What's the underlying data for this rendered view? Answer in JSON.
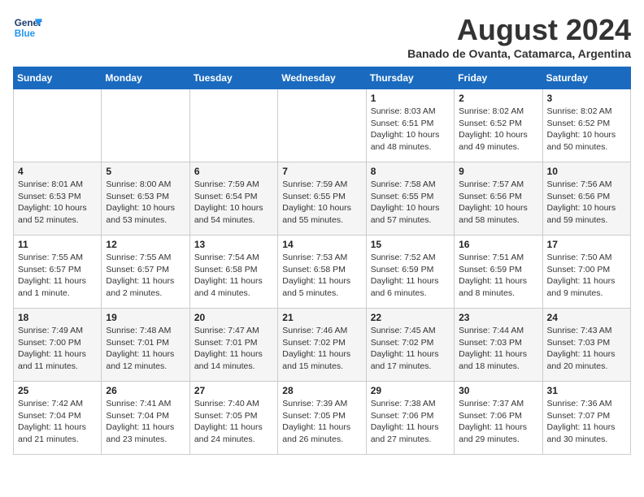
{
  "header": {
    "logo_line1": "General",
    "logo_line2": "Blue",
    "month_year": "August 2024",
    "location": "Banado de Ovanta, Catamarca, Argentina"
  },
  "days_of_week": [
    "Sunday",
    "Monday",
    "Tuesday",
    "Wednesday",
    "Thursday",
    "Friday",
    "Saturday"
  ],
  "weeks": [
    [
      {
        "day": "",
        "sunrise": "",
        "sunset": "",
        "daylight": ""
      },
      {
        "day": "",
        "sunrise": "",
        "sunset": "",
        "daylight": ""
      },
      {
        "day": "",
        "sunrise": "",
        "sunset": "",
        "daylight": ""
      },
      {
        "day": "",
        "sunrise": "",
        "sunset": "",
        "daylight": ""
      },
      {
        "day": "1",
        "sunrise": "Sunrise: 8:03 AM",
        "sunset": "Sunset: 6:51 PM",
        "daylight": "Daylight: 10 hours and 48 minutes."
      },
      {
        "day": "2",
        "sunrise": "Sunrise: 8:02 AM",
        "sunset": "Sunset: 6:52 PM",
        "daylight": "Daylight: 10 hours and 49 minutes."
      },
      {
        "day": "3",
        "sunrise": "Sunrise: 8:02 AM",
        "sunset": "Sunset: 6:52 PM",
        "daylight": "Daylight: 10 hours and 50 minutes."
      }
    ],
    [
      {
        "day": "4",
        "sunrise": "Sunrise: 8:01 AM",
        "sunset": "Sunset: 6:53 PM",
        "daylight": "Daylight: 10 hours and 52 minutes."
      },
      {
        "day": "5",
        "sunrise": "Sunrise: 8:00 AM",
        "sunset": "Sunset: 6:53 PM",
        "daylight": "Daylight: 10 hours and 53 minutes."
      },
      {
        "day": "6",
        "sunrise": "Sunrise: 7:59 AM",
        "sunset": "Sunset: 6:54 PM",
        "daylight": "Daylight: 10 hours and 54 minutes."
      },
      {
        "day": "7",
        "sunrise": "Sunrise: 7:59 AM",
        "sunset": "Sunset: 6:55 PM",
        "daylight": "Daylight: 10 hours and 55 minutes."
      },
      {
        "day": "8",
        "sunrise": "Sunrise: 7:58 AM",
        "sunset": "Sunset: 6:55 PM",
        "daylight": "Daylight: 10 hours and 57 minutes."
      },
      {
        "day": "9",
        "sunrise": "Sunrise: 7:57 AM",
        "sunset": "Sunset: 6:56 PM",
        "daylight": "Daylight: 10 hours and 58 minutes."
      },
      {
        "day": "10",
        "sunrise": "Sunrise: 7:56 AM",
        "sunset": "Sunset: 6:56 PM",
        "daylight": "Daylight: 10 hours and 59 minutes."
      }
    ],
    [
      {
        "day": "11",
        "sunrise": "Sunrise: 7:55 AM",
        "sunset": "Sunset: 6:57 PM",
        "daylight": "Daylight: 11 hours and 1 minute."
      },
      {
        "day": "12",
        "sunrise": "Sunrise: 7:55 AM",
        "sunset": "Sunset: 6:57 PM",
        "daylight": "Daylight: 11 hours and 2 minutes."
      },
      {
        "day": "13",
        "sunrise": "Sunrise: 7:54 AM",
        "sunset": "Sunset: 6:58 PM",
        "daylight": "Daylight: 11 hours and 4 minutes."
      },
      {
        "day": "14",
        "sunrise": "Sunrise: 7:53 AM",
        "sunset": "Sunset: 6:58 PM",
        "daylight": "Daylight: 11 hours and 5 minutes."
      },
      {
        "day": "15",
        "sunrise": "Sunrise: 7:52 AM",
        "sunset": "Sunset: 6:59 PM",
        "daylight": "Daylight: 11 hours and 6 minutes."
      },
      {
        "day": "16",
        "sunrise": "Sunrise: 7:51 AM",
        "sunset": "Sunset: 6:59 PM",
        "daylight": "Daylight: 11 hours and 8 minutes."
      },
      {
        "day": "17",
        "sunrise": "Sunrise: 7:50 AM",
        "sunset": "Sunset: 7:00 PM",
        "daylight": "Daylight: 11 hours and 9 minutes."
      }
    ],
    [
      {
        "day": "18",
        "sunrise": "Sunrise: 7:49 AM",
        "sunset": "Sunset: 7:00 PM",
        "daylight": "Daylight: 11 hours and 11 minutes."
      },
      {
        "day": "19",
        "sunrise": "Sunrise: 7:48 AM",
        "sunset": "Sunset: 7:01 PM",
        "daylight": "Daylight: 11 hours and 12 minutes."
      },
      {
        "day": "20",
        "sunrise": "Sunrise: 7:47 AM",
        "sunset": "Sunset: 7:01 PM",
        "daylight": "Daylight: 11 hours and 14 minutes."
      },
      {
        "day": "21",
        "sunrise": "Sunrise: 7:46 AM",
        "sunset": "Sunset: 7:02 PM",
        "daylight": "Daylight: 11 hours and 15 minutes."
      },
      {
        "day": "22",
        "sunrise": "Sunrise: 7:45 AM",
        "sunset": "Sunset: 7:02 PM",
        "daylight": "Daylight: 11 hours and 17 minutes."
      },
      {
        "day": "23",
        "sunrise": "Sunrise: 7:44 AM",
        "sunset": "Sunset: 7:03 PM",
        "daylight": "Daylight: 11 hours and 18 minutes."
      },
      {
        "day": "24",
        "sunrise": "Sunrise: 7:43 AM",
        "sunset": "Sunset: 7:03 PM",
        "daylight": "Daylight: 11 hours and 20 minutes."
      }
    ],
    [
      {
        "day": "25",
        "sunrise": "Sunrise: 7:42 AM",
        "sunset": "Sunset: 7:04 PM",
        "daylight": "Daylight: 11 hours and 21 minutes."
      },
      {
        "day": "26",
        "sunrise": "Sunrise: 7:41 AM",
        "sunset": "Sunset: 7:04 PM",
        "daylight": "Daylight: 11 hours and 23 minutes."
      },
      {
        "day": "27",
        "sunrise": "Sunrise: 7:40 AM",
        "sunset": "Sunset: 7:05 PM",
        "daylight": "Daylight: 11 hours and 24 minutes."
      },
      {
        "day": "28",
        "sunrise": "Sunrise: 7:39 AM",
        "sunset": "Sunset: 7:05 PM",
        "daylight": "Daylight: 11 hours and 26 minutes."
      },
      {
        "day": "29",
        "sunrise": "Sunrise: 7:38 AM",
        "sunset": "Sunset: 7:06 PM",
        "daylight": "Daylight: 11 hours and 27 minutes."
      },
      {
        "day": "30",
        "sunrise": "Sunrise: 7:37 AM",
        "sunset": "Sunset: 7:06 PM",
        "daylight": "Daylight: 11 hours and 29 minutes."
      },
      {
        "day": "31",
        "sunrise": "Sunrise: 7:36 AM",
        "sunset": "Sunset: 7:07 PM",
        "daylight": "Daylight: 11 hours and 30 minutes."
      }
    ]
  ]
}
